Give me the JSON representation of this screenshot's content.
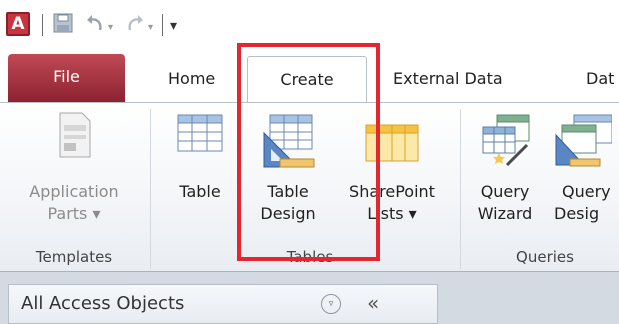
{
  "qat": {
    "app_icon_letter": "A",
    "icons": [
      "access-logo-icon",
      "save-icon",
      "undo-icon",
      "redo-icon",
      "customize-qat-icon"
    ],
    "customize_glyph": "▾"
  },
  "tabs": [
    {
      "label": "File"
    },
    {
      "label": "Home"
    },
    {
      "label": "Create"
    },
    {
      "label": "External Data"
    },
    {
      "label": "Dat"
    }
  ],
  "ribbon": {
    "groups": [
      {
        "label": "Templates"
      },
      {
        "label": "Tables"
      },
      {
        "label": "Queries"
      }
    ],
    "buttons": {
      "application_parts": {
        "line1": "Application",
        "line2": "Parts ▾"
      },
      "table": {
        "line1": "Table"
      },
      "table_design": {
        "line1": "Table",
        "line2": "Design"
      },
      "sharepoint_lists": {
        "line1": "SharePoint",
        "line2": "Lists ▾"
      },
      "query_wizard": {
        "line1": "Query",
        "line2": "Wizard"
      },
      "query_design": {
        "line1": "Query",
        "line2": "Desig"
      }
    }
  },
  "nav": {
    "title": "All Access Objects",
    "dropdown_glyph": "▿",
    "collapse_glyph": "«"
  },
  "colors": {
    "file_tab": "#a0303c",
    "highlight": "#e3262f",
    "accent_blue": "#3b6fb6"
  }
}
